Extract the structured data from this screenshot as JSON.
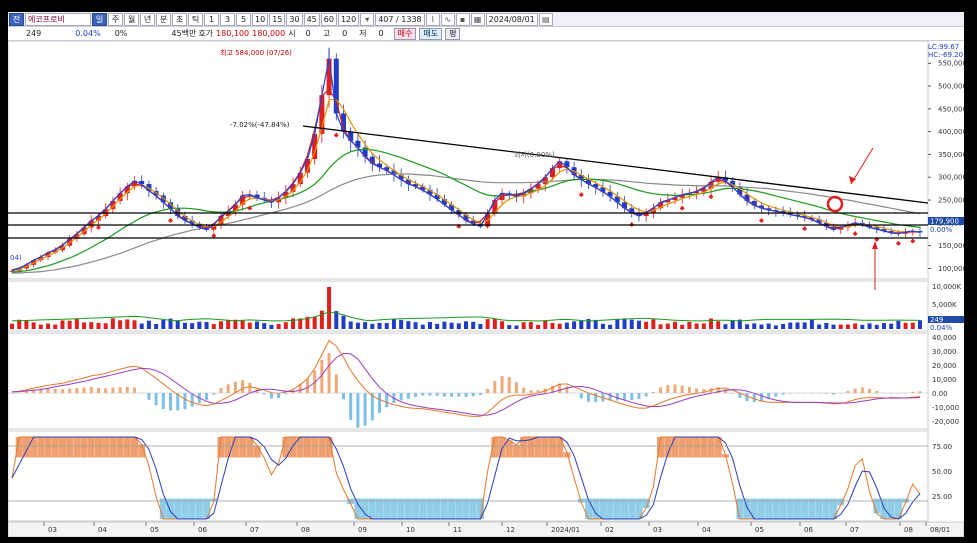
{
  "toolbar": {
    "icon_label": "전",
    "stock_name": "에코프로비",
    "period_tabs": [
      "일",
      "주",
      "월",
      "년",
      "분",
      "초",
      "틱"
    ],
    "selected_tab": "일",
    "interval_options": [
      "1",
      "3",
      "5",
      "10",
      "15",
      "30",
      "45",
      "60",
      "120"
    ],
    "count": "407 / 1338",
    "date": "2024/08/01"
  },
  "infobar": {
    "price": "249",
    "change_pct": "0.04%",
    "zero_pct": "0%",
    "volume_label": "45백만",
    "quote_label": "호가",
    "bid": "180,100",
    "ask": "180,000",
    "open_label": "시",
    "open_val": "0",
    "high_label": "고",
    "high_val": "0",
    "low_label": "저",
    "low_val": "0",
    "buy_button": "매수",
    "sell_button": "매도",
    "avg_label": "평"
  },
  "chart_data": [
    {
      "type": "candlestick",
      "annotations": [
        "최고 584,000 (07/26)",
        "-7.02%(-47.84%)",
        "최저(0.00%)"
      ],
      "y_ticks": [
        "550,000",
        "500,000",
        "450,000",
        "400,000",
        "350,000",
        "300,000",
        "250,000",
        "200,000",
        "150,000",
        "100,000"
      ],
      "y_range": [
        90000,
        590000
      ],
      "right_labels": [
        "LC:99.67",
        "HC:-69.20",
        "179,900",
        "0.00%"
      ],
      "left_label": "04)",
      "x_ticks": [
        "03",
        "04",
        "05",
        "06",
        "07",
        "08",
        "09",
        "10",
        "11",
        "12",
        "2024/01",
        "02",
        "03",
        "04",
        "05",
        "06",
        "07",
        "08",
        "08/01"
      ],
      "close_series": [
        95,
        100,
        108,
        118,
        125,
        135,
        140,
        150,
        165,
        175,
        190,
        205,
        215,
        230,
        248,
        265,
        280,
        292,
        285,
        270,
        260,
        245,
        232,
        215,
        205,
        198,
        190,
        185,
        195,
        215,
        225,
        240,
        260,
        262,
        255,
        250,
        245,
        255,
        268,
        285,
        310,
        340,
        395,
        480,
        560,
        440,
        400,
        380,
        365,
        345,
        330,
        322,
        315,
        305,
        295,
        285,
        280,
        272,
        262,
        252,
        240,
        228,
        218,
        205,
        198,
        192,
        220,
        250,
        265,
        262,
        258,
        265,
        275,
        285,
        300,
        320,
        335,
        322,
        305,
        295,
        285,
        278,
        268,
        258,
        245,
        232,
        222,
        215,
        222,
        232,
        245,
        250,
        255,
        262,
        265,
        268,
        275,
        290,
        300,
        292,
        280,
        262,
        248,
        238,
        232,
        228,
        226,
        222,
        218,
        215,
        212,
        208,
        200,
        192,
        185,
        190,
        195,
        200,
        196,
        190,
        186,
        182,
        178,
        176,
        180,
        182,
        179
      ],
      "ma_short": [
        95,
        98,
        104,
        112,
        120,
        128,
        136,
        145,
        156,
        168,
        181,
        195,
        207,
        220,
        236,
        252,
        267,
        280,
        283,
        276,
        266,
        254,
        241,
        227,
        214,
        204,
        196,
        190,
        192,
        202,
        213,
        226,
        243,
        253,
        254,
        252,
        249,
        250,
        258,
        270,
        290,
        315,
        355,
        410,
        470,
        470,
        450,
        420,
        395,
        372,
        352,
        338,
        326,
        315,
        305,
        295,
        287,
        280,
        271,
        262,
        251,
        240,
        229,
        217,
        207,
        199,
        205,
        222,
        240,
        252,
        257,
        260,
        265,
        272,
        282,
        296,
        312,
        318,
        313,
        305,
        296,
        288,
        279,
        270,
        259,
        248,
        237,
        228,
        224,
        227,
        234,
        241,
        247,
        253,
        258,
        262,
        267,
        276,
        286,
        289,
        284,
        275,
        264,
        253,
        244,
        237,
        232,
        228,
        224,
        220,
        216,
        212,
        207,
        201,
        194,
        191,
        192,
        195,
        197,
        195,
        192,
        188,
        184,
        181,
        180,
        180,
        180
      ],
      "ma_mid": [
        92,
        93,
        95,
        98,
        102,
        106,
        111,
        117,
        123,
        130,
        138,
        146,
        155,
        164,
        174,
        184,
        194,
        203,
        212,
        219,
        224,
        228,
        231,
        232,
        232,
        231,
        229,
        226,
        224,
        223,
        224,
        226,
        230,
        235,
        240,
        244,
        248,
        251,
        255,
        260,
        266,
        274,
        285,
        300,
        320,
        336,
        348,
        356,
        360,
        361,
        360,
        357,
        353,
        348,
        343,
        337,
        331,
        325,
        319,
        313,
        306,
        298,
        290,
        282,
        274,
        266,
        261,
        259,
        259,
        261,
        263,
        266,
        269,
        272,
        276,
        281,
        287,
        292,
        295,
        296,
        296,
        295,
        293,
        290,
        286,
        281,
        276,
        271,
        267,
        264,
        262,
        261,
        260,
        261,
        262,
        263,
        265,
        268,
        272,
        275,
        276,
        275,
        273,
        270,
        267,
        263,
        259,
        255,
        251,
        247,
        243,
        239,
        235,
        230,
        225,
        221,
        217,
        214,
        211,
        208,
        205,
        202,
        199,
        196,
        194,
        192,
        190
      ],
      "ma_long": [
        90,
        90,
        91,
        92,
        93,
        95,
        97,
        100,
        103,
        106,
        110,
        114,
        118,
        123,
        128,
        133,
        139,
        145,
        151,
        157,
        162,
        167,
        172,
        176,
        180,
        184,
        187,
        190,
        193,
        196,
        199,
        202,
        206,
        210,
        214,
        218,
        222,
        226,
        230,
        235,
        240,
        246,
        253,
        261,
        270,
        278,
        285,
        291,
        296,
        300,
        303,
        305,
        306,
        307,
        307,
        307,
        306,
        305,
        304,
        302,
        300,
        298,
        296,
        294,
        292,
        290,
        289,
        288,
        288,
        288,
        288,
        288,
        289,
        289,
        290,
        291,
        292,
        293,
        294,
        295,
        295,
        295,
        295,
        294,
        293,
        292,
        290,
        289,
        287,
        286,
        285,
        284,
        283,
        282,
        282,
        281,
        281,
        281,
        281,
        281,
        280,
        279,
        278,
        277,
        276,
        275,
        273,
        271,
        269,
        267,
        265,
        263,
        260,
        258,
        255,
        252,
        250,
        247,
        244,
        241,
        238,
        235,
        232,
        229,
        226,
        223,
        220
      ]
    },
    {
      "type": "bar",
      "name": "volume",
      "y_ticks": [
        "10,000K",
        "5,000K"
      ],
      "right_labels": [
        "249",
        "0.04%"
      ]
    },
    {
      "type": "line",
      "name": "macd",
      "y_ticks": [
        "40,000",
        "30,000",
        "20,000",
        "10,000",
        "0.00",
        "-10,000",
        "-20,000"
      ]
    },
    {
      "type": "line",
      "name": "stochastic",
      "y_ticks": [
        "75.00",
        "50.00",
        "25.00"
      ]
    }
  ],
  "colors": {
    "up": "#e0201c",
    "down": "#1f3cc7",
    "ma_short": "#e59400",
    "ma_mid": "#1a9a1a",
    "ma_long": "#8a8a8a",
    "price_tag": "#1f4aa8"
  }
}
